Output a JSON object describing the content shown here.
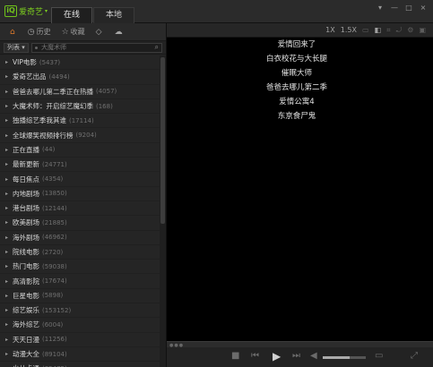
{
  "app": {
    "name": "爱奇艺"
  },
  "tabs": [
    {
      "label": "在线"
    },
    {
      "label": "本地"
    }
  ],
  "window_controls": [
    "▾",
    "—",
    "□",
    "×"
  ],
  "nav": [
    {
      "label": "",
      "icon": "home-icon"
    },
    {
      "label": "历史",
      "icon": "history-icon"
    },
    {
      "label": "收藏",
      "icon": "star-icon"
    },
    {
      "label": "",
      "icon": "tag-icon"
    },
    {
      "label": "",
      "icon": "cloud-icon"
    }
  ],
  "search": {
    "list_label": "列表",
    "placeholder": "大魔术师"
  },
  "channels": [
    {
      "name": "VIP电影",
      "count": "(5437)"
    },
    {
      "name": "爱奇艺出品",
      "count": "(4494)"
    },
    {
      "name": "爸爸去哪儿第二季正在热播",
      "count": "(4057)"
    },
    {
      "name": "大魔术师：开启综艺魔幻季",
      "count": "(168)"
    },
    {
      "name": "独播综艺季我其谁",
      "count": "(17114)"
    },
    {
      "name": "全球爆笑视频排行榜",
      "count": "(9204)"
    },
    {
      "name": "正在直播",
      "count": "(44)"
    },
    {
      "name": "最新更新",
      "count": "(24771)"
    },
    {
      "name": "每日焦点",
      "count": "(4354)"
    },
    {
      "name": "内地剧场",
      "count": "(13850)"
    },
    {
      "name": "港台剧场",
      "count": "(12144)"
    },
    {
      "name": "欧美剧场",
      "count": "(21885)"
    },
    {
      "name": "海外剧场",
      "count": "(46962)"
    },
    {
      "name": "院线电影",
      "count": "(2720)"
    },
    {
      "name": "热门电影",
      "count": "(59038)"
    },
    {
      "name": "高清影院",
      "count": "(17674)"
    },
    {
      "name": "巨星电影",
      "count": "(5898)"
    },
    {
      "name": "综艺娱乐",
      "count": "(153152)"
    },
    {
      "name": "海外综艺",
      "count": "(6004)"
    },
    {
      "name": "天天日漫",
      "count": "(11256)"
    },
    {
      "name": "动漫大全",
      "count": "(89104)"
    },
    {
      "name": "少儿卡通",
      "count": "(89475)"
    }
  ],
  "player_toolbar": [
    "1X",
    "1.5X"
  ],
  "playlist": [
    "爱情回来了",
    "白衣校花与大长腿",
    "催眠大师",
    "爸爸去哪儿第二季",
    "爱情公寓4",
    "东京食尸鬼"
  ],
  "volume_level": 0.62,
  "colors": {
    "accent_green": "#6fc21a",
    "home_orange": "#e07a2a"
  }
}
